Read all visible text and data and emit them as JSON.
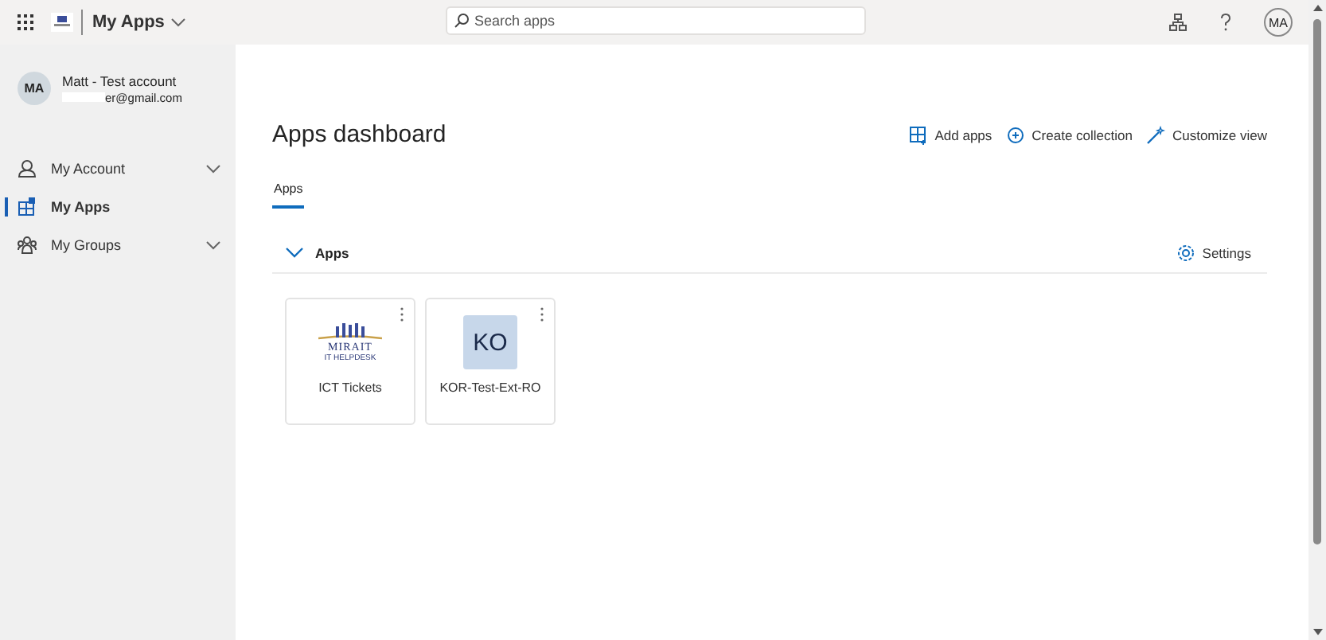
{
  "topbar": {
    "app_title": "My Apps",
    "search_placeholder": "Search apps",
    "avatar_initials": "MA"
  },
  "profile": {
    "initials": "MA",
    "name": "Matt - Test account",
    "email": "er@gmail.com"
  },
  "nav": [
    {
      "label": "My Account",
      "kind": "account",
      "selected": false,
      "expandable": true
    },
    {
      "label": "My Apps",
      "kind": "apps",
      "selected": true,
      "expandable": false
    },
    {
      "label": "My Groups",
      "kind": "groups",
      "selected": false,
      "expandable": true
    }
  ],
  "header": {
    "title": "Apps dashboard",
    "actions": [
      {
        "label": "Add apps",
        "kind": "add"
      },
      {
        "label": "Create collection",
        "kind": "collection"
      },
      {
        "label": "Customize view",
        "kind": "customize"
      }
    ]
  },
  "tabs": [
    {
      "label": "Apps",
      "selected": true
    }
  ],
  "section": {
    "title": "Apps",
    "expanded": true,
    "settings_label": "Settings"
  },
  "apps": [
    {
      "name": "ICT Tickets",
      "kind": "logo",
      "logo_text": "MIRAIT",
      "logo_subtext": "IT HELPDESK"
    },
    {
      "name": "KOR-Test-Ext-RO",
      "kind": "initials",
      "initials": "KO"
    }
  ]
}
